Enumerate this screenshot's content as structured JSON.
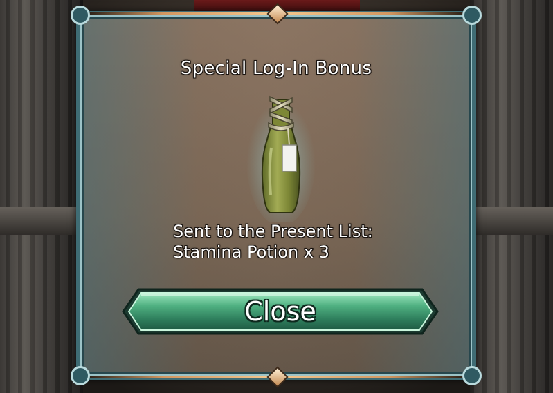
{
  "dialog": {
    "title": "Special Log-In Bonus",
    "item_icon": "stamina-potion-icon",
    "message_line1": "Sent to the Present List:",
    "message_line2": "Stamina Potion x 3",
    "close_label": "Close"
  },
  "colors": {
    "panel_border": "#3f6c74",
    "trim_gold": "#f6c88e",
    "button_green": "#5fbf8a",
    "text": "#ffffff"
  }
}
